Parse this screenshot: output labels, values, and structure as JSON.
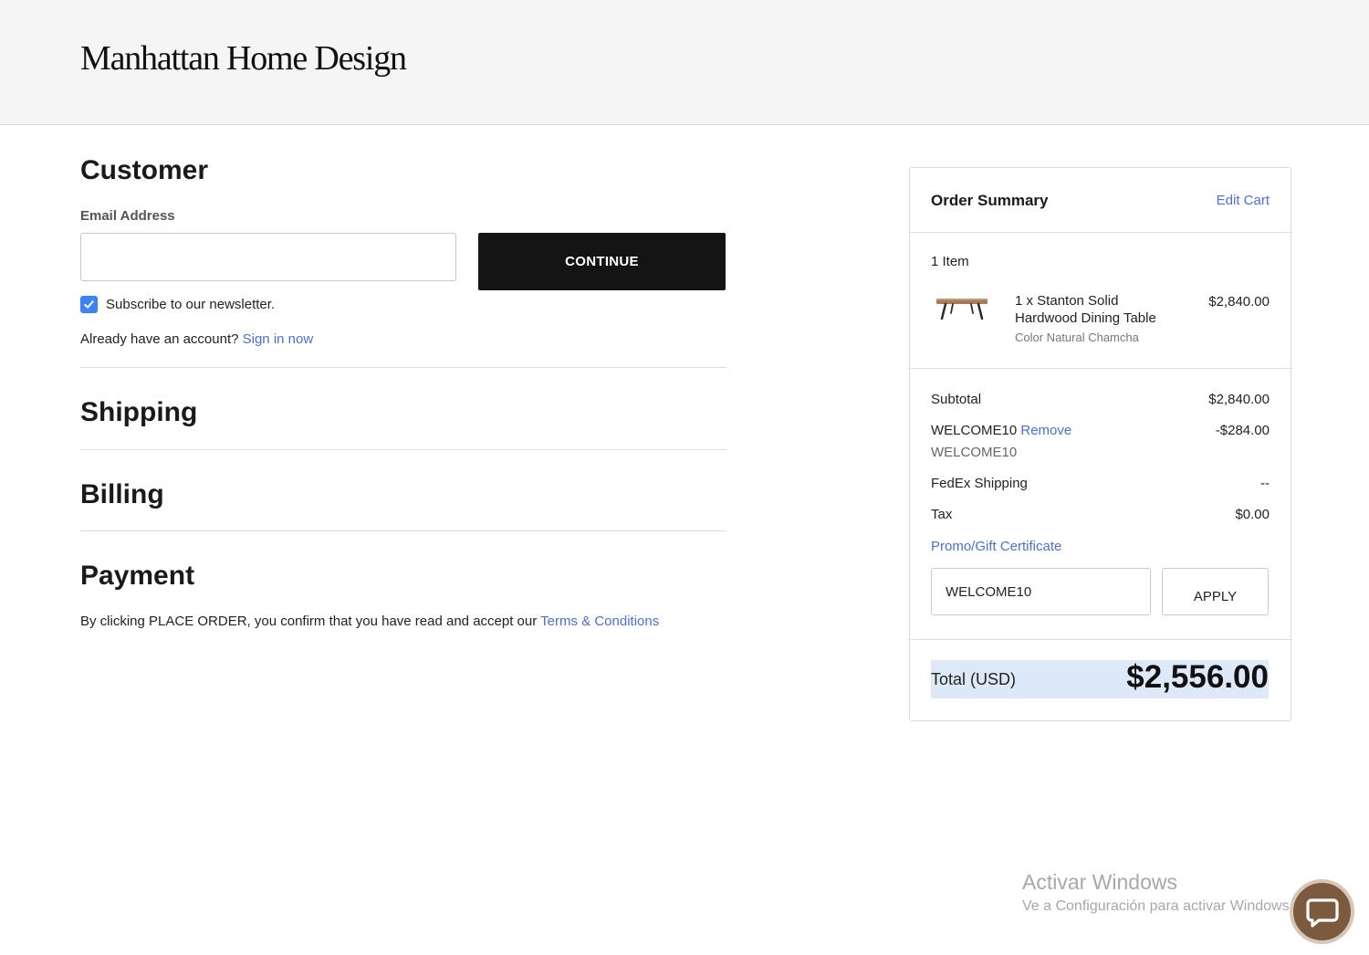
{
  "header": {
    "logo": "Manhattan Home Design"
  },
  "customer": {
    "title": "Customer",
    "email_label": "Email Address",
    "email_value": "",
    "continue_label": "CONTINUE",
    "newsletter_label": "Subscribe to our newsletter.",
    "newsletter_checked": true,
    "account_prompt": "Already have an account?",
    "sign_in_label": "Sign in now"
  },
  "shipping": {
    "title": "Shipping"
  },
  "billing": {
    "title": "Billing"
  },
  "payment": {
    "title": "Payment",
    "note_prefix": "By clicking PLACE ORDER, you confirm that you have read and accept our",
    "terms_label": "Terms & Conditions"
  },
  "summary": {
    "title": "Order Summary",
    "edit_cart_label": "Edit Cart",
    "items_count": "1 Item",
    "item": {
      "name": "1 x Stanton Solid Hardwood Dining Table",
      "variant": "Color Natural Chamcha",
      "price": "$2,840.00",
      "image_icon": "dining-table-thumbnail"
    },
    "subtotal_label": "Subtotal",
    "subtotal_value": "$2,840.00",
    "coupon_label": "WELCOME10",
    "coupon_remove_label": "Remove",
    "coupon_code": "WELCOME10",
    "coupon_value": "-$284.00",
    "shipping_label": "FedEx Shipping",
    "shipping_value": "--",
    "tax_label": "Tax",
    "tax_value": "$0.00",
    "promo_link_label": "Promo/Gift Certificate",
    "promo_input_value": "WELCOME10",
    "apply_label": "APPLY",
    "total_label": "Total (USD)",
    "total_value": "$2,556.00"
  },
  "watermark": {
    "title": "Activar Windows",
    "subtitle": "Ve a Configuración para activar Windows."
  },
  "chat": {
    "icon": "chat-bubble-icon"
  },
  "colors": {
    "link": "#4a6fd6",
    "checkbox": "#3b82f6",
    "total_highlight": "#dde8f8",
    "button_dark": "#141414",
    "chat_button": "#7b5a3e"
  }
}
